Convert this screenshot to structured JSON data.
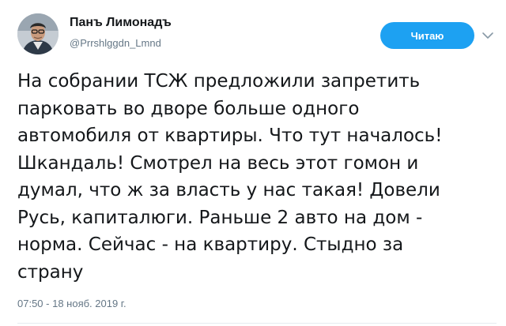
{
  "author": {
    "display_name": "Панъ Лимонадъ",
    "handle": "@Prrshlggdn_Lmnd",
    "avatar_icon": "user-avatar-photo"
  },
  "actions": {
    "follow_label": "Читаю",
    "menu_icon": "chevron-down-icon",
    "accent_color": "#1da1f2"
  },
  "tweet": {
    "lines": [
      "На собрании ТСЖ предложили запретить",
      "парковать во дворе больше одного",
      "автомобиля от квартиры. Что тут началось!",
      "Шкандаль! Смотрел на весь этот гомон и",
      "думал, что ж за власть у нас такая! Довели",
      "Русь, капиталюги. Раньше 2 авто на дом -",
      "норма. Сейчас - на квартиру. Стыдно за",
      "страну"
    ],
    "timestamp": "07:50 - 18 нояб. 2019 г."
  }
}
